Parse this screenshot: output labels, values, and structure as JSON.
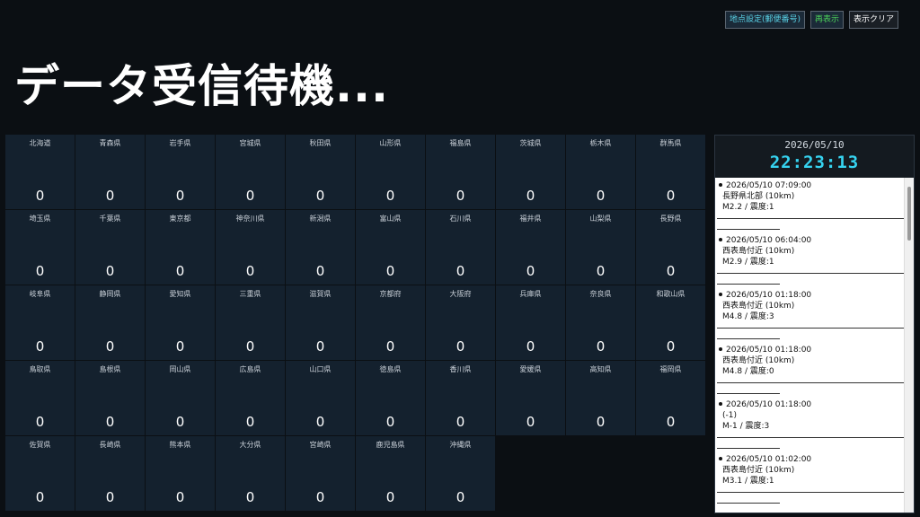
{
  "toolbar": {
    "location_label": "地点設定(郵便番号)",
    "redisplay_label": "再表示",
    "clear_label": "表示クリア"
  },
  "headline": "データ受信待機...",
  "prefectures": [
    {
      "name": "北海道",
      "count": "0"
    },
    {
      "name": "青森県",
      "count": "0"
    },
    {
      "name": "岩手県",
      "count": "0"
    },
    {
      "name": "宮城県",
      "count": "0"
    },
    {
      "name": "秋田県",
      "count": "0"
    },
    {
      "name": "山形県",
      "count": "0"
    },
    {
      "name": "福島県",
      "count": "0"
    },
    {
      "name": "茨城県",
      "count": "0"
    },
    {
      "name": "栃木県",
      "count": "0"
    },
    {
      "name": "群馬県",
      "count": "0"
    },
    {
      "name": "埼玉県",
      "count": "0"
    },
    {
      "name": "千葉県",
      "count": "0"
    },
    {
      "name": "東京都",
      "count": "0"
    },
    {
      "name": "神奈川県",
      "count": "0"
    },
    {
      "name": "新潟県",
      "count": "0"
    },
    {
      "name": "富山県",
      "count": "0"
    },
    {
      "name": "石川県",
      "count": "0"
    },
    {
      "name": "福井県",
      "count": "0"
    },
    {
      "name": "山梨県",
      "count": "0"
    },
    {
      "name": "長野県",
      "count": "0"
    },
    {
      "name": "岐阜県",
      "count": "0"
    },
    {
      "name": "静岡県",
      "count": "0"
    },
    {
      "name": "愛知県",
      "count": "0"
    },
    {
      "name": "三重県",
      "count": "0"
    },
    {
      "name": "滋賀県",
      "count": "0"
    },
    {
      "name": "京都府",
      "count": "0"
    },
    {
      "name": "大阪府",
      "count": "0"
    },
    {
      "name": "兵庫県",
      "count": "0"
    },
    {
      "name": "奈良県",
      "count": "0"
    },
    {
      "name": "和歌山県",
      "count": "0"
    },
    {
      "name": "鳥取県",
      "count": "0"
    },
    {
      "name": "島根県",
      "count": "0"
    },
    {
      "name": "岡山県",
      "count": "0"
    },
    {
      "name": "広島県",
      "count": "0"
    },
    {
      "name": "山口県",
      "count": "0"
    },
    {
      "name": "徳島県",
      "count": "0"
    },
    {
      "name": "香川県",
      "count": "0"
    },
    {
      "name": "愛媛県",
      "count": "0"
    },
    {
      "name": "高知県",
      "count": "0"
    },
    {
      "name": "福岡県",
      "count": "0"
    },
    {
      "name": "佐賀県",
      "count": "0"
    },
    {
      "name": "長崎県",
      "count": "0"
    },
    {
      "name": "熊本県",
      "count": "0"
    },
    {
      "name": "大分県",
      "count": "0"
    },
    {
      "name": "宮崎県",
      "count": "0"
    },
    {
      "name": "鹿児島県",
      "count": "0"
    },
    {
      "name": "沖縄県",
      "count": "0"
    }
  ],
  "clock": {
    "date": "2026/05/10",
    "time": "22:23:13"
  },
  "feed": [
    {
      "datetime": "2026/05/10 07:09:00",
      "place": "長野県北部 (10km)",
      "info": "M2.2 / 震度:1"
    },
    {
      "datetime": "2026/05/10 06:04:00",
      "place": "西表島付近 (10km)",
      "info": "M2.9 / 震度:1"
    },
    {
      "datetime": "2026/05/10 01:18:00",
      "place": "西表島付近 (10km)",
      "info": "M4.8 / 震度:3"
    },
    {
      "datetime": "2026/05/10 01:18:00",
      "place": "西表島付近 (10km)",
      "info": "M4.8 / 震度:0"
    },
    {
      "datetime": "2026/05/10 01:18:00",
      "place": " (-1)",
      "info": "M-1 / 震度:3"
    },
    {
      "datetime": "2026/05/10 01:02:00",
      "place": "西表島付近 (10km)",
      "info": "M3.1 / 震度:1"
    }
  ],
  "colors": {
    "accent": "#36d3f0",
    "cell_bg": "#14212e",
    "page_bg": "#0b0f13"
  }
}
